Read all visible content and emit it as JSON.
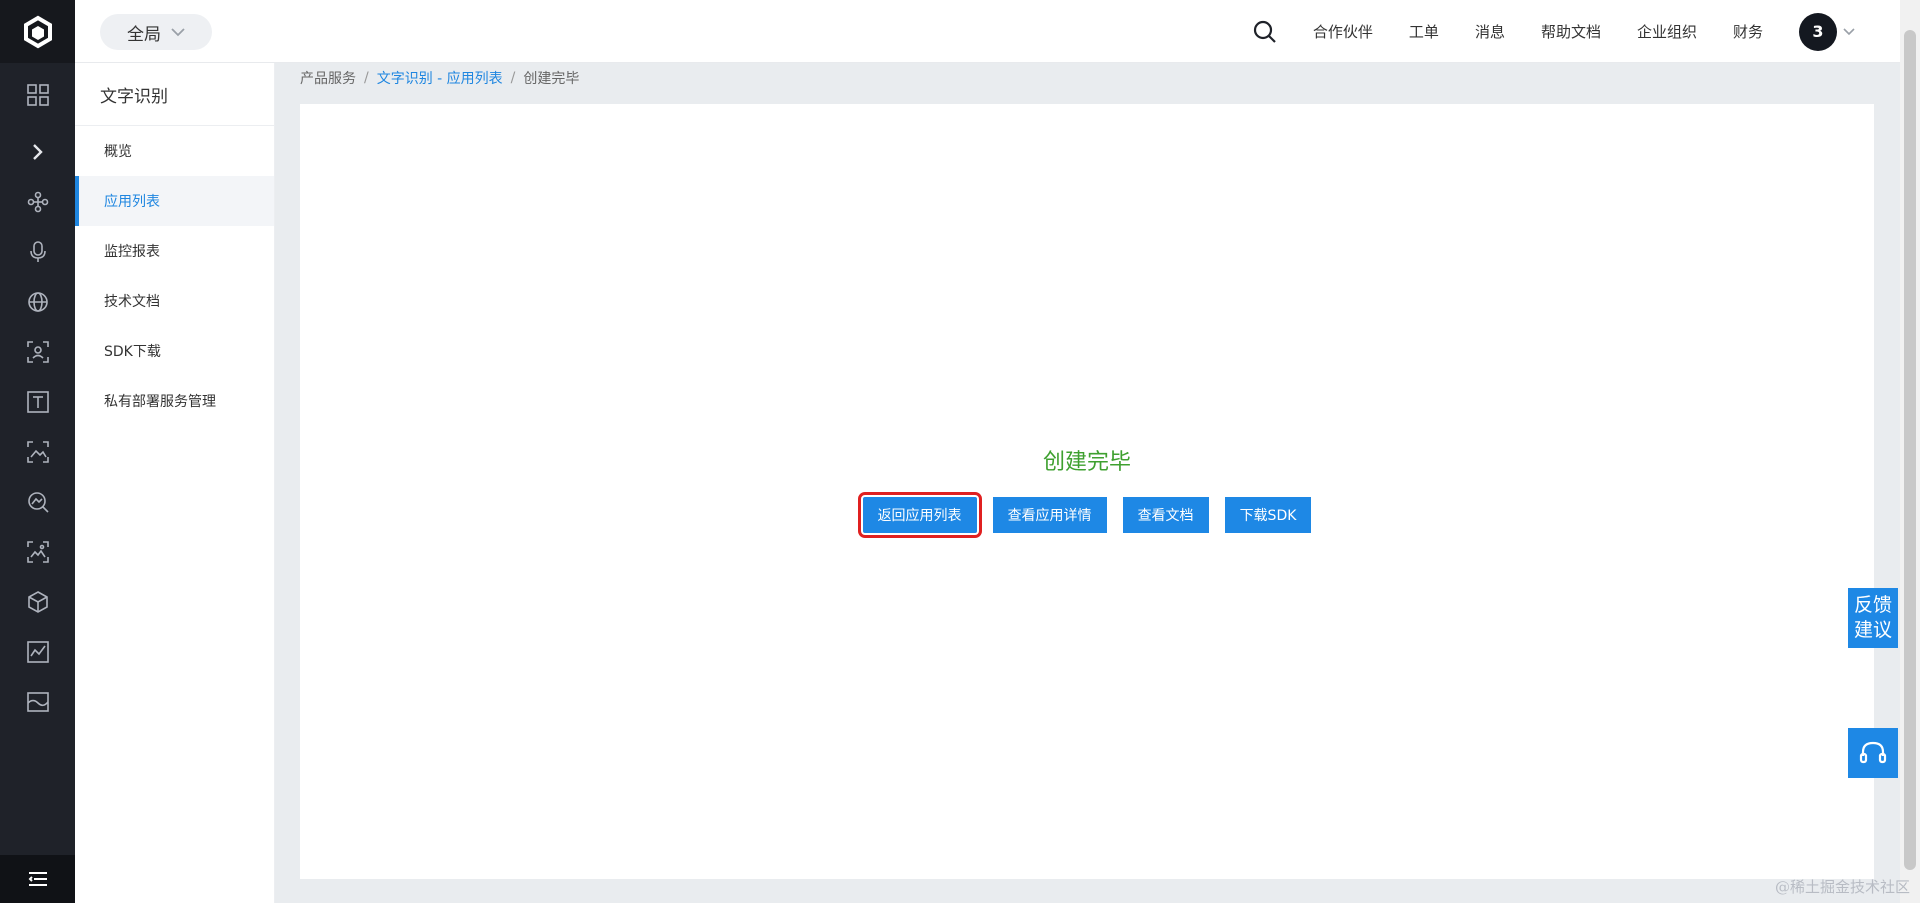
{
  "topbar": {
    "scope_label": "全局",
    "nav": [
      "合作伙伴",
      "工单",
      "消息",
      "帮助文档",
      "企业组织",
      "财务"
    ],
    "avatar_text": "3"
  },
  "sidebar": {
    "title": "文字识别",
    "items": [
      {
        "label": "概览"
      },
      {
        "label": "应用列表"
      },
      {
        "label": "监控报表"
      },
      {
        "label": "技术文档"
      },
      {
        "label": "SDK下载"
      },
      {
        "label": "私有部署服务管理"
      }
    ],
    "active_item": "应用列表"
  },
  "breadcrumb": {
    "root": "产品服务",
    "link": "文字识别 - 应用列表",
    "current": "创建完毕"
  },
  "main": {
    "status_title": "创建完毕",
    "buttons": {
      "back_to_list": "返回应用列表",
      "view_details": "查看应用详情",
      "view_docs": "查看文档",
      "download_sdk": "下载SDK"
    }
  },
  "float": {
    "feedback_line1": "反馈",
    "feedback_line2": "建议"
  },
  "watermark": "@稀土掘金技术社区",
  "colors": {
    "rail_bg": "#1f2229",
    "accent": "#1e88e5",
    "success": "#3ea02f",
    "highlight": "#e02020"
  },
  "rail_icons": [
    "logo-icon",
    "dashboard-grid-icon",
    "expand-chevron-icon",
    "network-nodes-icon",
    "microphone-icon",
    "globe-icon",
    "face-scan-icon",
    "text-recognition-icon",
    "image-scan-icon",
    "image-search-icon",
    "image-recognition-icon",
    "cube-icon",
    "chart-image-icon",
    "landscape-image-icon",
    "menu-collapse-icon"
  ]
}
